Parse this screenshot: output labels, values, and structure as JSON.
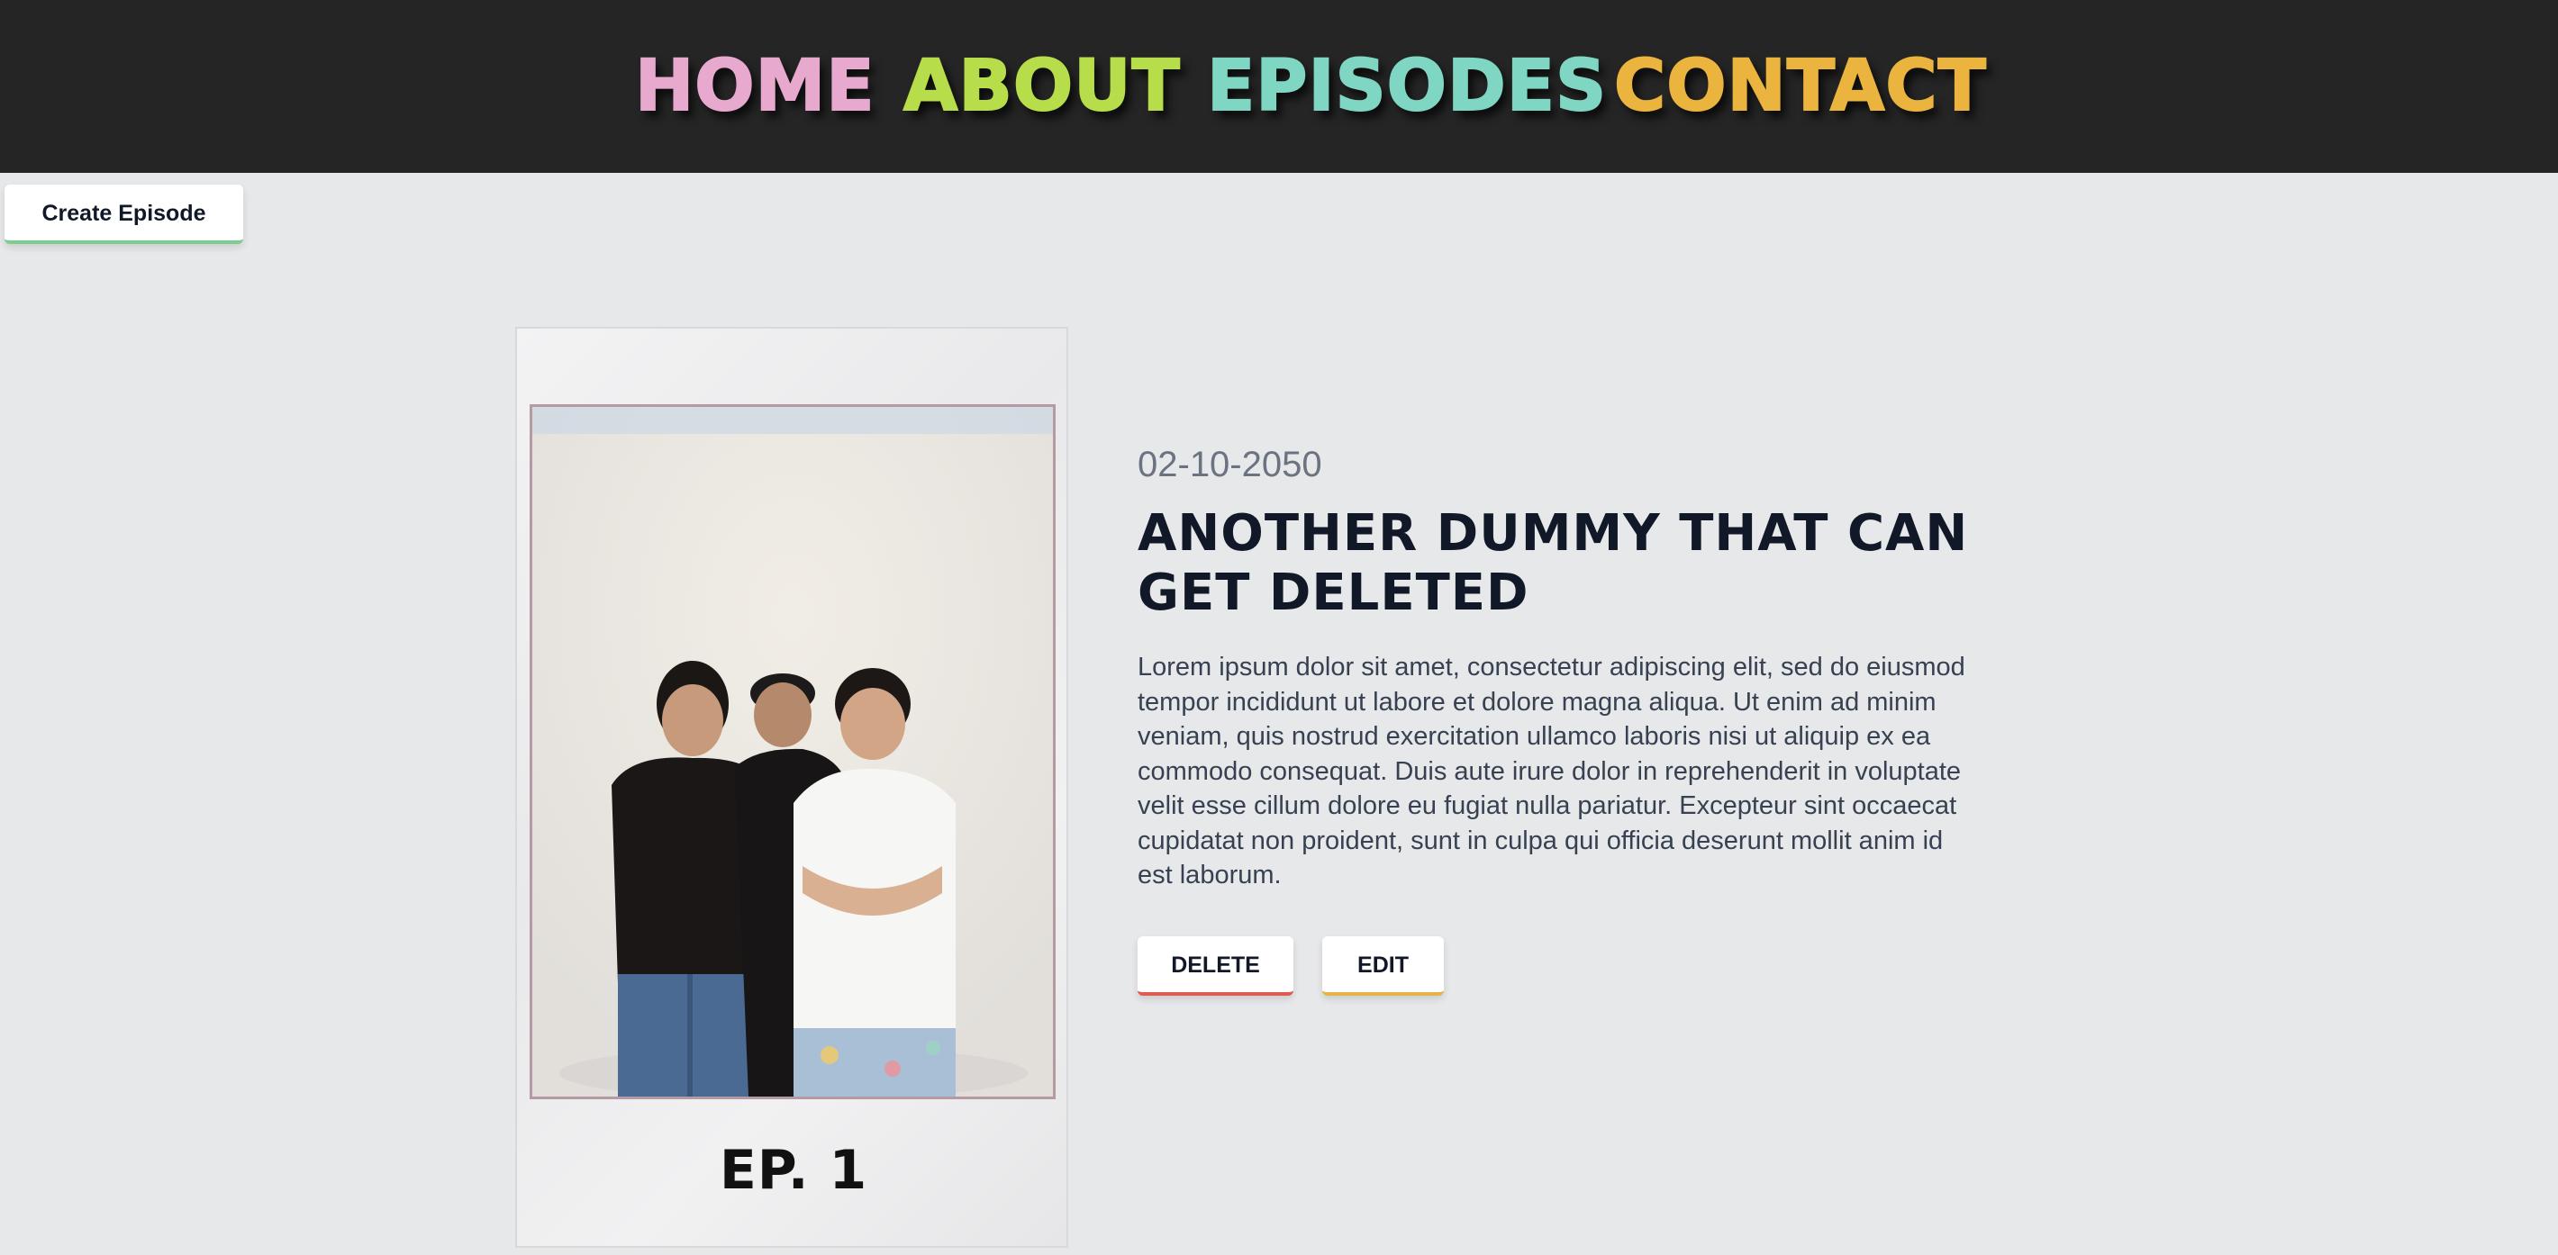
{
  "nav": {
    "items": [
      {
        "label": "HOME",
        "color": "#e8a9cf"
      },
      {
        "label": "ABOUT",
        "color": "#b7dd4a"
      },
      {
        "label": "EPISODES",
        "color": "#7fd6c3"
      },
      {
        "label": "CONTACT",
        "color": "#ebb43f"
      }
    ]
  },
  "toolbar": {
    "create_label": "Create Episode"
  },
  "episode": {
    "label": "EP. 1",
    "date": "02-10-2050",
    "title": "ANOTHER DUMMY THAT CAN GET DELETED",
    "description": "Lorem ipsum dolor sit amet, consectetur adipiscing elit, sed do eiusmod tempor incididunt ut labore et dolore magna aliqua. Ut enim ad minim veniam, quis nostrud exercitation ullamco laboris nisi ut aliquip ex ea commodo consequat. Duis aute irure dolor in reprehenderit in voluptate velit esse cillum dolore eu fugiat nulla pariatur. Excepteur sint occaecat cupidatat non proident, sunt in culpa qui officia deserunt mollit anim id est laborum.",
    "delete_label": "DELETE",
    "edit_label": "EDIT"
  }
}
